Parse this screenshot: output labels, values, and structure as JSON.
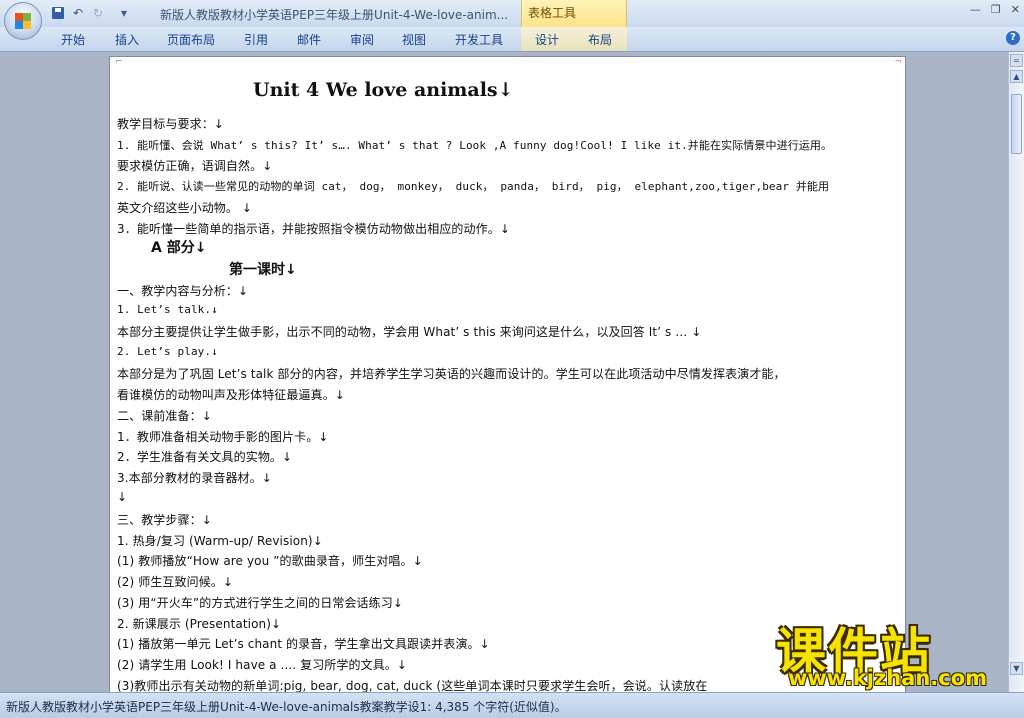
{
  "window": {
    "title": "新版人教版教材小学英语PEP三年级上册Unit-4-We-love-anim...",
    "context_tab_group": "表格工具",
    "minimize_glyph": "—",
    "restore_glyph": "❐",
    "close_glyph": "✕"
  },
  "quick_access": {
    "undo_glyph": "↶",
    "redo_glyph": "↻",
    "more_glyph": "▾"
  },
  "ribbon": {
    "tabs": [
      "开始",
      "插入",
      "页面布局",
      "引用",
      "邮件",
      "审阅",
      "视图",
      "开发工具",
      "设计",
      "布局"
    ],
    "help_glyph": "?"
  },
  "document": {
    "heading": "Unit 4 We love animals↓",
    "lines": [
      "教学目标与要求：↓",
      "1. 能听懂、会说 What’ s this? It’ s…. What’ s that ? Look ,A funny dog!Cool! I like it.并能在实际情景中进行运用。",
      "要求模仿正确，语调自然。↓",
      "2.  能听说、认读一些常见的动物的单词 cat， dog， monkey， duck， panda，    bird， pig， elephant,zoo,tiger,bear 并能用",
      "英文介绍这些小动物。  ↓",
      "3．能听懂一些简单的指示语，并能按照指令模仿动物做出相应的动作。↓",
      "一、教学内容与分析：↓",
      "1. Let’s talk.↓",
      "本部分主要提供让学生做手影，出示不同的动物，学会用 What’ s this 来询问这是什么，以及回答 It’ s …  ↓",
      "2. Let’s play.↓",
      "本部分是为了巩固 Let’s talk 部分的内容，并培养学生学习英语的兴趣而设计的。学生可以在此项活动中尽情发挥表演才能，",
      "看谁模仿的动物叫声及形体特征最逼真。↓",
      "二、课前准备：↓",
      "1．教师准备相关动物手影的图片卡。↓",
      "2．学生准备有关文具的实物。↓",
      "3.本部分教材的录音器材。↓",
      "↓",
      "三、教学步骤：↓",
      "1.  热身/复习 (Warm-up/ Revision)↓",
      "(1) 教师播放“How are you ”的歌曲录音，师生对唱。↓",
      "(2) 师生互致问候。↓",
      "(3) 用“开火车”的方式进行学生之间的日常会话练习↓",
      "2.  新课展示 (Presentation)↓",
      "(1) 播放第一单元 Let’s chant 的录音，学生拿出文具跟读并表演。↓",
      "(2) 请学生用 Look! I have a .... 复习所学的文具。↓",
      "(3)教师出示有关动物的新单词:pig, bear, dog, cat, duck (这些单词本课时只要求学生会听，会说。认读放在"
    ],
    "section_a": "A 部分↓",
    "lesson_title": "第一课时↓"
  },
  "statusbar": {
    "text": "新版人教版教材小学英语PEP三年级上册Unit-4-We-love-animals教案教学设1: 4,385 个字符(近似值)。"
  },
  "watermark": {
    "cn": "课件站",
    "url": "www.kjzhan.com"
  },
  "scrollbar": {
    "up_glyph": "▲",
    "down_glyph": "▼",
    "split_glyph": "="
  }
}
